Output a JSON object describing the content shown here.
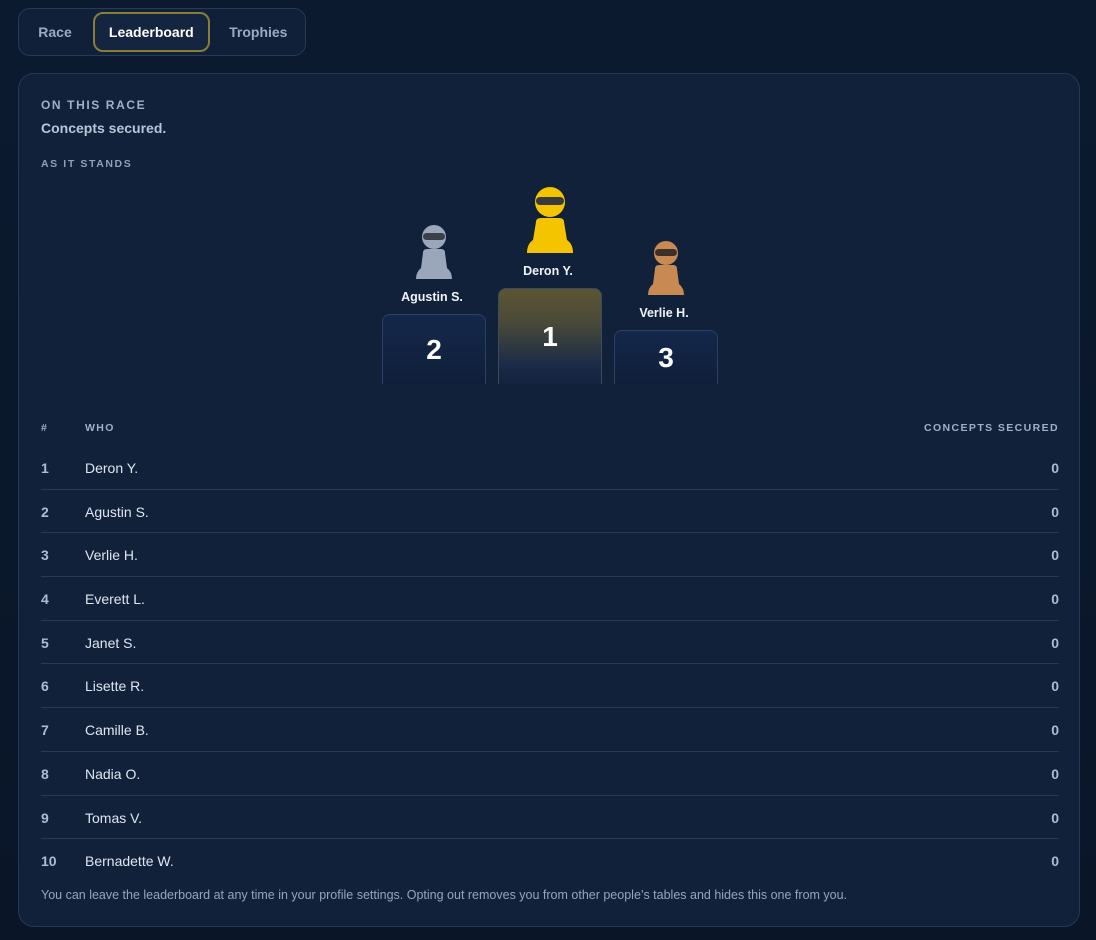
{
  "tabs": [
    {
      "label": "Race"
    },
    {
      "label": "Leaderboard"
    },
    {
      "label": "Trophies"
    }
  ],
  "panel": {
    "eyebrow": "ON THIS RACE",
    "headline": "Concepts secured.",
    "standing_label": "AS IT STANDS"
  },
  "podium": {
    "first": {
      "name": "Deron Y.",
      "place": "1",
      "color": "#f5c400",
      "visor": "#3a3a3a"
    },
    "second": {
      "name": "Agustin S.",
      "place": "2",
      "color": "#9aa7bb",
      "visor": "#3a3f48"
    },
    "third": {
      "name": "Verlie H.",
      "place": "3",
      "color": "#c88a52",
      "visor": "#3d3028"
    }
  },
  "table": {
    "headers": {
      "rank": "#",
      "who": "WHO",
      "score": "CONCEPTS SECURED"
    },
    "rows": [
      {
        "rank": "1",
        "who": "Deron Y.",
        "score": "0"
      },
      {
        "rank": "2",
        "who": "Agustin S.",
        "score": "0"
      },
      {
        "rank": "3",
        "who": "Verlie H.",
        "score": "0"
      },
      {
        "rank": "4",
        "who": "Everett L.",
        "score": "0"
      },
      {
        "rank": "5",
        "who": "Janet S.",
        "score": "0"
      },
      {
        "rank": "6",
        "who": "Lisette R.",
        "score": "0"
      },
      {
        "rank": "7",
        "who": "Camille B.",
        "score": "0"
      },
      {
        "rank": "8",
        "who": "Nadia O.",
        "score": "0"
      },
      {
        "rank": "9",
        "who": "Tomas V.",
        "score": "0"
      },
      {
        "rank": "10",
        "who": "Bernadette W.",
        "score": "0"
      }
    ]
  },
  "footnote": "You can leave the leaderboard at any time in your profile settings. Opting out removes you from other people’s tables and hides this one from you."
}
